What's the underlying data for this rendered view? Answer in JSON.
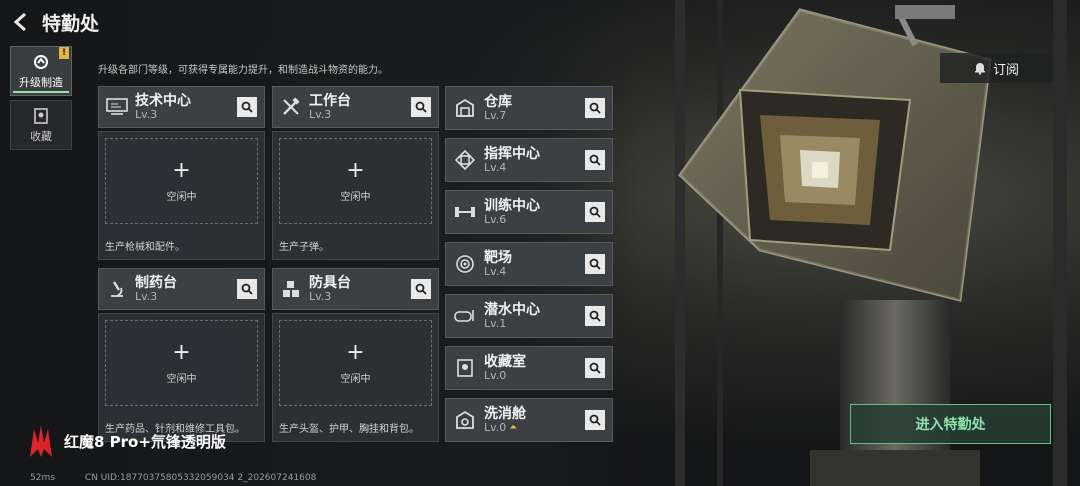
{
  "header": {
    "title": "特勤处"
  },
  "sidebar": {
    "tabs": [
      {
        "label": "升级制造",
        "badge": "!"
      },
      {
        "label": "收藏"
      }
    ]
  },
  "intro": "升级各部门等级，可获得专属能力提升，和制造战斗物资的能力。",
  "cards": [
    {
      "name": "技术中心",
      "level": "Lv.3",
      "slot": "空闲中",
      "desc": "生产枪械和配件。",
      "icon": "computer-icon"
    },
    {
      "name": "工作台",
      "level": "Lv.3",
      "slot": "空闲中",
      "desc": "生产子弹。",
      "icon": "tools-icon"
    },
    {
      "name": "制药台",
      "level": "Lv.3",
      "slot": "空闲中",
      "desc": "生产药品、针剂和维修工具包。",
      "icon": "microscope-icon"
    },
    {
      "name": "防具台",
      "level": "Lv.3",
      "slot": "空闲中",
      "desc": "生产头盔、护甲、胸挂和背包。",
      "icon": "armor-boxes-icon"
    }
  ],
  "facilities": [
    {
      "name": "仓库",
      "level": "Lv.7",
      "icon": "warehouse-icon"
    },
    {
      "name": "指挥中心",
      "level": "Lv.4",
      "icon": "chip-icon"
    },
    {
      "name": "训练中心",
      "level": "Lv.6",
      "icon": "dumbbell-icon"
    },
    {
      "name": "靶场",
      "level": "Lv.4",
      "icon": "target-icon"
    },
    {
      "name": "潜水中心",
      "level": "Lv.1",
      "icon": "diving-mask-icon"
    },
    {
      "name": "收藏室",
      "level": "Lv.0",
      "icon": "collection-icon"
    },
    {
      "name": "洗消舱",
      "level": "Lv.0",
      "icon": "decon-icon",
      "upgradable": true
    }
  ],
  "subscribe_label": "订阅",
  "enter_label": "进入特勤处",
  "watermark": "红魔8 Pro+氘锋透明版",
  "footer": {
    "ping": "52ms",
    "uid": "CN UID:18770375805332059034 2_202607241608"
  },
  "colors": {
    "accent_green": "#5fbf86",
    "badge_yellow": "#e5b43c",
    "upgrade_arrow": "#e6b34a"
  }
}
